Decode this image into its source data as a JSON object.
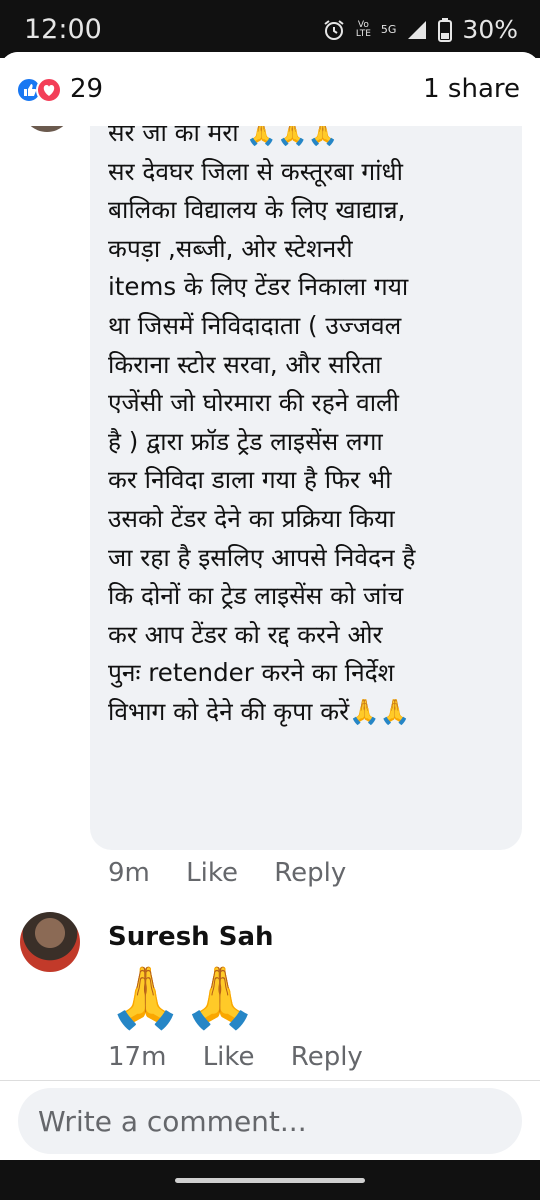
{
  "status_bar": {
    "time": "12:00",
    "network_top": "Vo",
    "network_bottom": "LTE",
    "network_type": "5G",
    "battery": "30%"
  },
  "reactions": {
    "count": "29",
    "shares": "1 share"
  },
  "comment1": {
    "text": "सर जी को मेरा 🙏🙏🙏\nसर देवघर जिला से कस्तूरबा गांधी\nबालिका विद्यालय के लिए खाद्यान्न,\nकपड़ा ,सब्जी, ओर स्टेशनरी\nitems के लिए टेंडर निकाला गया\nथा जिसमें निविदादाता ( उज्जवल\nकिराना स्टोर सरवा, और सरिता\nएजेंसी जो घोरमारा की रहने वाली\nहै ) द्वारा फ्रॉड ट्रेड लाइसेंस लगा\nकर निविदा डाला गया है फिर भी\nउसको टेंडर देने का प्रक्रिया किया\nजा रहा है इसलिए आपसे निवेदन है\nकि दोनों का ट्रेड लाइसेंस को जांच\nकर आप टेंडर को रद्द करने ओर\nपुनः retender करने का निर्देश\nविभाग को देने की कृपा करें🙏🙏",
    "time": "9m",
    "like": "Like",
    "reply": "Reply"
  },
  "comment2": {
    "author": "Suresh Sah",
    "text": "🙏🙏",
    "time": "17m",
    "like": "Like",
    "reply": "Reply"
  },
  "composer": {
    "placeholder": "Write a comment..."
  },
  "icons": [
    "alarm-icon",
    "signal-icon",
    "battery-icon",
    "like-reaction-icon",
    "love-reaction-icon"
  ],
  "colors": {
    "like_blue": "#1877f2",
    "love_red": "#f33e58",
    "bubble_bg": "#f0f2f5",
    "meta_gray": "#65676b"
  }
}
